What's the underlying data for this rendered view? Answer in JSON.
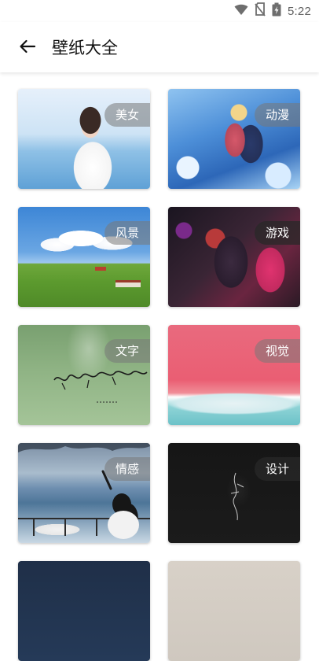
{
  "status_bar": {
    "time": "5:22",
    "icons": [
      "wifi-icon",
      "no-sim-icon",
      "battery-charging-icon"
    ]
  },
  "app_bar": {
    "title": "壁纸大全",
    "back_icon": "arrow-left-icon"
  },
  "categories": [
    {
      "label": "美女"
    },
    {
      "label": "动漫"
    },
    {
      "label": "风景"
    },
    {
      "label": "游戏"
    },
    {
      "label": "文字"
    },
    {
      "label": "视觉"
    },
    {
      "label": "情感"
    },
    {
      "label": "设计"
    }
  ],
  "colors": {
    "label_background": "#787878",
    "title": "#111111",
    "status_icon": "#6e6e6e"
  }
}
